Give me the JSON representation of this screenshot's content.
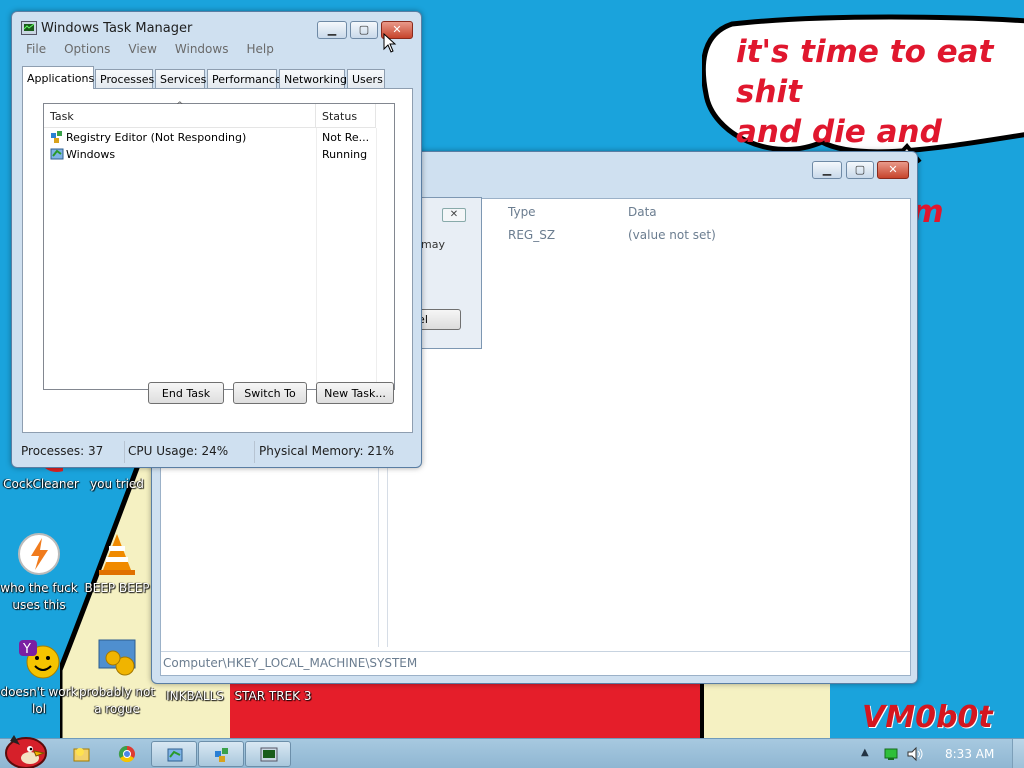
{
  "desktop": {
    "speech_lines": [
      "it's time to eat shit",
      "and die and chew",
      "bubble gum"
    ],
    "watermark": "VM0b0t",
    "icons": [
      {
        "label": "CockCleaner"
      },
      {
        "label": "you tried"
      },
      {
        "label": "who the fuck uses this"
      },
      {
        "label": "BEEP BEEP"
      },
      {
        "label": "doesn't work lol"
      },
      {
        "label": "probably not a rogue"
      },
      {
        "label": "INKBALLS"
      },
      {
        "label": "STAR TREK 3"
      }
    ]
  },
  "regedit": {
    "col_type": "Type",
    "col_data": "Data",
    "row_type": "REG_SZ",
    "row_data": "(value not set)",
    "status_path": "Computer\\HKEY_LOCAL_MACHINE\\SYSTEM"
  },
  "dialog": {
    "text_fragment": "may",
    "button_fragment": "cel",
    "close_glyph": "✕"
  },
  "taskmgr": {
    "title": "Windows Task Manager",
    "menu": [
      "File",
      "Options",
      "View",
      "Windows",
      "Help"
    ],
    "tabs": [
      "Applications",
      "Processes",
      "Services",
      "Performance",
      "Networking",
      "Users"
    ],
    "active_tab": "Applications",
    "columns": {
      "task": "Task",
      "status": "Status"
    },
    "rows": [
      {
        "task": "Registry Editor (Not Responding)",
        "status": "Not Re..."
      },
      {
        "task": "Windows",
        "status": "Running"
      }
    ],
    "buttons": {
      "end_task": "End Task",
      "switch_to": "Switch To",
      "new_task": "New Task..."
    },
    "status": {
      "processes": "Processes: 37",
      "cpu": "CPU Usage: 24%",
      "memory": "Physical Memory: 21%"
    },
    "caption": {
      "minimize": "▁",
      "maximize": "▢",
      "close": "✕"
    }
  },
  "taskbar": {
    "clock": "8:33 AM",
    "tray_up": "▲",
    "buttons": [
      "angry-bird-start",
      "folder-sun",
      "chrome",
      "windows-app",
      "regedit",
      "task-manager"
    ]
  },
  "colors": {
    "desktop": "#1aa3dc",
    "speech_red": "#e0172e",
    "bar_red": "#e51e2a",
    "yellow": "#f5f1c2"
  }
}
